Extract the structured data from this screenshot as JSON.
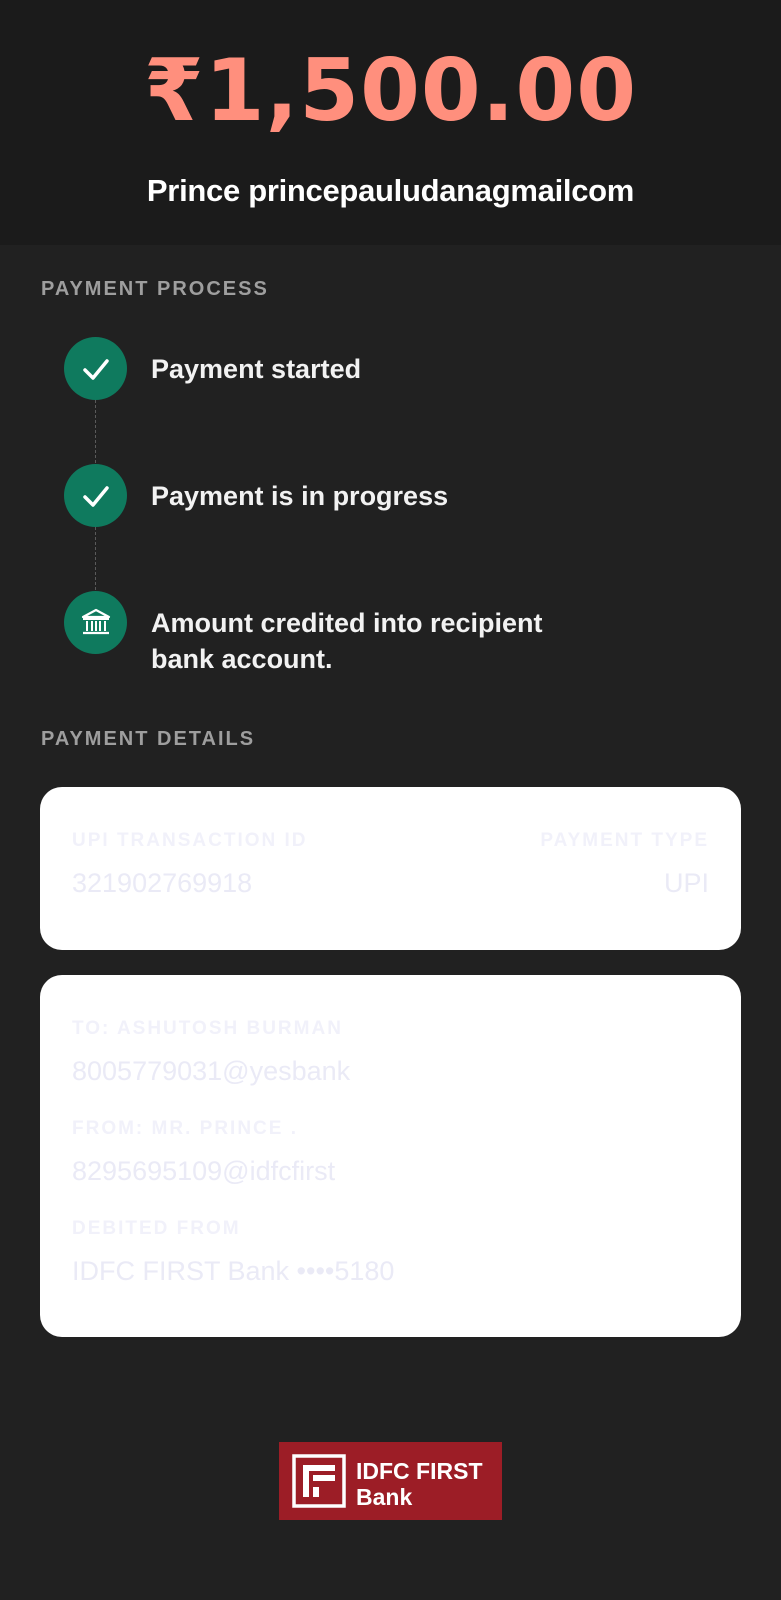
{
  "header": {
    "amount": "₹1,500.00",
    "recipient_name": "Prince princepauludanagmailcom"
  },
  "payment_process": {
    "title": "PAYMENT PROCESS",
    "steps": [
      {
        "label": "Payment started",
        "icon": "check-icon"
      },
      {
        "label": "Payment is in progress",
        "icon": "check-icon"
      },
      {
        "label": "Amount credited into recipient bank account.",
        "icon": "bank-icon"
      }
    ]
  },
  "payment_details": {
    "title": "PAYMENT DETAILS",
    "transaction_card": {
      "txn_id_label": "UPI TRANSACTION ID",
      "txn_id_value": "321902769918",
      "payment_type_label": "PAYMENT TYPE",
      "payment_type_value": "UPI"
    },
    "parties_card": {
      "to_label": "TO: ASHUTOSH  BURMAN",
      "to_value": "8005779031@yesbank",
      "from_label": "FROM: MR. PRINCE  .",
      "from_value": "8295695109@idfcfirst",
      "debited_label": "DEBITED FROM",
      "debited_value": "IDFC FIRST Bank ••••5180"
    }
  },
  "footer": {
    "logo_line1": "IDFC FIRST",
    "logo_line2": "Bank",
    "logo_color": "#9c1d26"
  },
  "colors": {
    "accent_amount": "#ff8f7d",
    "step_green": "#0f7a5e",
    "background": "#212121"
  }
}
